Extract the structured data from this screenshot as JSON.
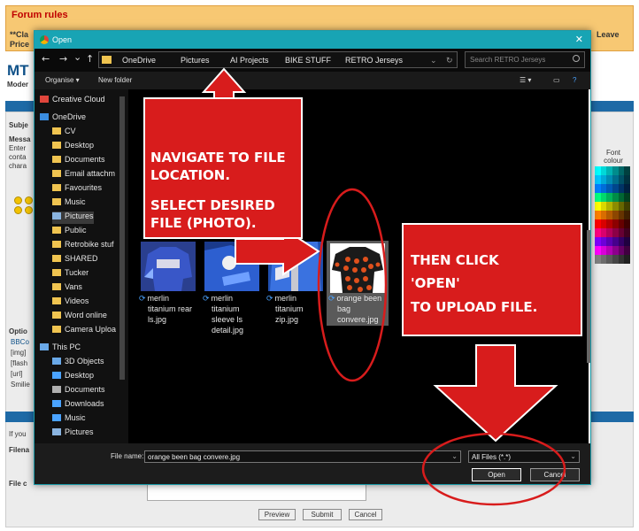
{
  "forum": {
    "rules_title": "Forum rules",
    "rules_line1": "**Cla",
    "rules_line2": "Price",
    "rules_right1": "Leave",
    "rules_right2": "",
    "heading": "MT",
    "subheading": "Moder",
    "subject_label": "Subje",
    "message_label": "Messa",
    "message_lines": [
      "Enter",
      "conta",
      "chara"
    ],
    "options_label": "Optio",
    "options_lines": [
      "BBCo",
      "[img]",
      "[flash",
      "[url]",
      "Smilie"
    ],
    "if_you": "If you",
    "filename_label": "Filena",
    "file_comment_label": "File c",
    "font_colour": "Font colour",
    "buttons": {
      "preview": "Preview",
      "submit": "Submit",
      "cancel": "Cancel"
    }
  },
  "dialog": {
    "title": "Open",
    "close_glyph": "✕",
    "nav": {
      "back": "←",
      "forward": "→",
      "down": "⌄",
      "up": "↑"
    },
    "breadcrumbs": [
      "OneDrive",
      "Pictures",
      "AI Projects",
      "BIKE STUFF",
      "RETRO Jerseys"
    ],
    "search_placeholder": "Search RETRO Jerseys",
    "toolbar": {
      "organise": "Organise ▾",
      "new_folder": "New folder",
      "help": "?"
    },
    "sidebar": [
      "Creative Cloud",
      "OneDrive",
      "CV",
      "Desktop",
      "Documents",
      "Email attachm",
      "Favourites",
      "Music",
      "Pictures",
      "Public",
      "Retrobike stuf",
      "SHARED",
      "Tucker",
      "Vans",
      "Videos",
      "Word online",
      "Camera Uploa",
      "This PC",
      "3D Objects",
      "Desktop",
      "Documents",
      "Downloads",
      "Music",
      "Pictures"
    ],
    "files": [
      {
        "name_lines": [
          "merlin",
          "titanium rear",
          "ls.jpg"
        ]
      },
      {
        "name_lines": [
          "merlin",
          "titanium",
          "sleeve ls",
          "detail.jpg"
        ]
      },
      {
        "name_lines": [
          "merlin",
          "titanium",
          "zip.jpg"
        ]
      },
      {
        "name_lines": [
          "orange been",
          "bag",
          "convere.jpg"
        ]
      }
    ],
    "file_name_label": "File name:",
    "file_name_value": "orange been bag convere.jpg",
    "file_type": "All Files (*.*)",
    "open_button": "Open",
    "cancel_button": "Cancel"
  },
  "annotations": {
    "callout1": [
      "NAVIGATE TO FILE",
      "LOCATION.",
      "SELECT DESIRED",
      "FILE (PHOTO)."
    ],
    "callout2": [
      "THEN CLICK",
      "'OPEN'",
      "TO UPLOAD FILE."
    ],
    "color": "#d81c1c"
  }
}
